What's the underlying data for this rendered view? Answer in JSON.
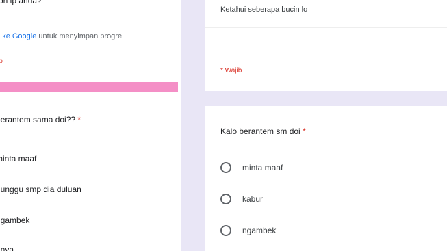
{
  "left_form": {
    "title_fragment": "on ip anda?",
    "signin_prefix": "o",
    "signin_link": "ke Google",
    "signin_suffix": "untuk menyimpan progre",
    "required_fragment": "ib",
    "progress_bar_color": "#f48fc6",
    "question": "berantem sama doi??",
    "question_star": "*",
    "options": [
      "minta maaf",
      "nunggu smp dia duluan",
      "ngambek",
      "nnya"
    ]
  },
  "card_top": {
    "answer_text": "Ketahui seberapa bucin lo",
    "required_note": "* Wajib"
  },
  "card_bottom": {
    "question": "Kalo berantem sm doi",
    "question_star": "*",
    "options": [
      "minta maaf",
      "kabur",
      "ngambek"
    ]
  },
  "colors": {
    "background": "#e9e6f6",
    "card": "#ffffff",
    "required": "#d93025",
    "link": "#1a73e8"
  }
}
